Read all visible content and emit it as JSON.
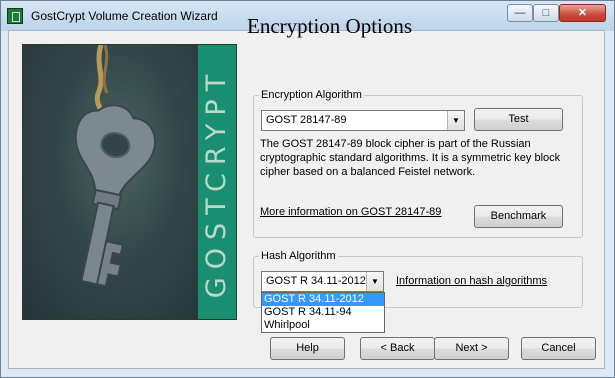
{
  "window": {
    "title": "GostCrypt Volume Creation Wizard",
    "minimize_glyph": "—",
    "maximize_glyph": "□",
    "close_glyph": "✕"
  },
  "sidebar": {
    "banner_text": "GOSTCRYPT",
    "image": "key-photo",
    "band_color": "#1a8e70"
  },
  "page": {
    "heading": "Encryption Options"
  },
  "encryption": {
    "legend": "Encryption Algorithm",
    "selected": "GOST 28147-89",
    "test_label": "Test",
    "description": "The GOST 28147-89 block cipher is part of the Russian cryptographic standard algorithms. It is a symmetric key block cipher based on a balanced Feistel network.",
    "more_info_link": "More information on GOST 28147-89",
    "benchmark_label": "Benchmark"
  },
  "hash": {
    "legend": "Hash Algorithm",
    "selected": "GOST R 34.11-2012",
    "info_link": "Information on hash algorithms",
    "options": [
      "GOST R 34.11-2012",
      "GOST R 34.11-94",
      "Whirlpool"
    ],
    "highlighted_index": 0
  },
  "footer": {
    "help": "Help",
    "back": "< Back",
    "next": "Next >",
    "cancel": "Cancel"
  },
  "colors": {
    "selection": "#3399ff",
    "accent_band": "#1a8e70"
  }
}
